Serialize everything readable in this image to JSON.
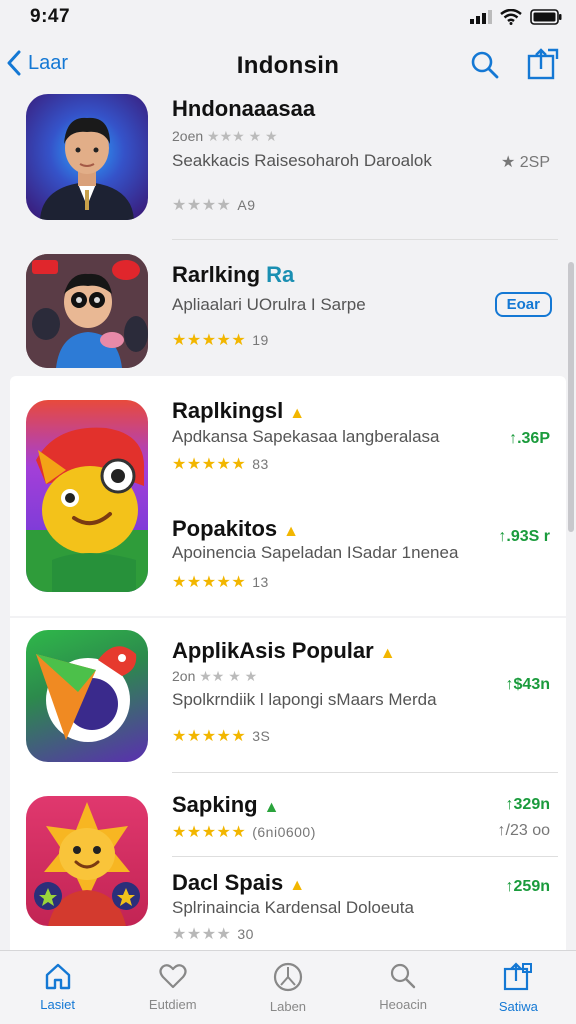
{
  "status": {
    "time": "9:47"
  },
  "nav": {
    "back_label": "Laar",
    "title": "Indonsin"
  },
  "apps": [
    {
      "title": "Hndonaaasaa",
      "meta": "2oen",
      "subtitle": "Seakkacis Raisesoharoh Daroalok",
      "rating_count": "A9",
      "price": "★ 2SP"
    },
    {
      "title": "Rarlking",
      "title_tag": "Ra",
      "subtitle": "Apliaalari UOrulra  I Sarpe",
      "rating_count": "19",
      "button_label": "Eoar"
    },
    {
      "title": "Raplkingsl",
      "subtitle": "Apdkansa Sapekasaa langberalasa",
      "rating_count": "83",
      "price": "↑.36P"
    },
    {
      "title": "Popakitos",
      "subtitle": "Apoinencia Sapeladan ISadar 1nenea",
      "rating_count": "13",
      "price": "↑.93S r"
    },
    {
      "title": "ApplikAsis Popular",
      "meta": "2on",
      "subtitle": "Spolkrndiik l lapongi sMaars Merda",
      "rating_count": "3S",
      "price": "↑$43n"
    },
    {
      "title": "Sapking",
      "rating_count": "(6ni0600)",
      "price": "↑329n",
      "price2": "↑/23 oo"
    },
    {
      "title": "Dacl Spais",
      "subtitle": "Splrinaincia Kardensal Doloeuta",
      "rating_count": "30",
      "price": "↑259n"
    }
  ],
  "tabs": [
    {
      "label": "Lasiet",
      "icon": "home-icon"
    },
    {
      "label": "Eutdiem",
      "icon": "heart-icon"
    },
    {
      "label": "Laben",
      "icon": "compass-icon"
    },
    {
      "label": "Heoacin",
      "icon": "search-icon"
    },
    {
      "label": "Satiwa",
      "icon": "share-icon"
    }
  ],
  "colors": {
    "accent": "#1478d4",
    "price_green": "#1a9b3c",
    "star": "#f2b600"
  }
}
